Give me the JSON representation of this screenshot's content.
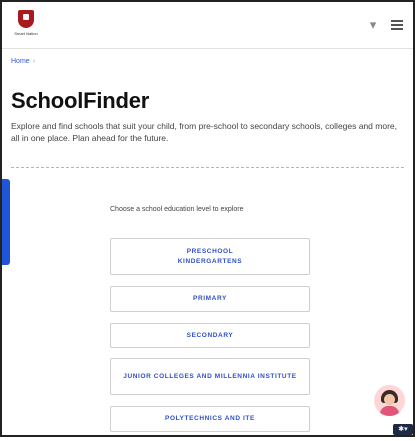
{
  "header": {
    "logo_text": "Smart Nation",
    "search_icon": "search-icon",
    "menu_icon": "menu-icon"
  },
  "breadcrumb": {
    "home": "Home"
  },
  "page": {
    "title": "SchoolFinder",
    "description": "Explore and find schools that suit your child, from pre-school to secondary schools, colleges and more, all in one place. Plan ahead for the future."
  },
  "finder": {
    "prompt": "Choose a school education level to explore",
    "options": [
      "PRESCHOOL\nKINDERGARTENS",
      "PRIMARY",
      "SECONDARY",
      "JUNIOR COLLEGES AND MILLENNIA INSTITUTE",
      "POLYTECHNICS AND ITE"
    ]
  },
  "widgets": {
    "assistant_icon": "assistant-avatar-icon",
    "badge_icon": "chat-badge-icon"
  }
}
